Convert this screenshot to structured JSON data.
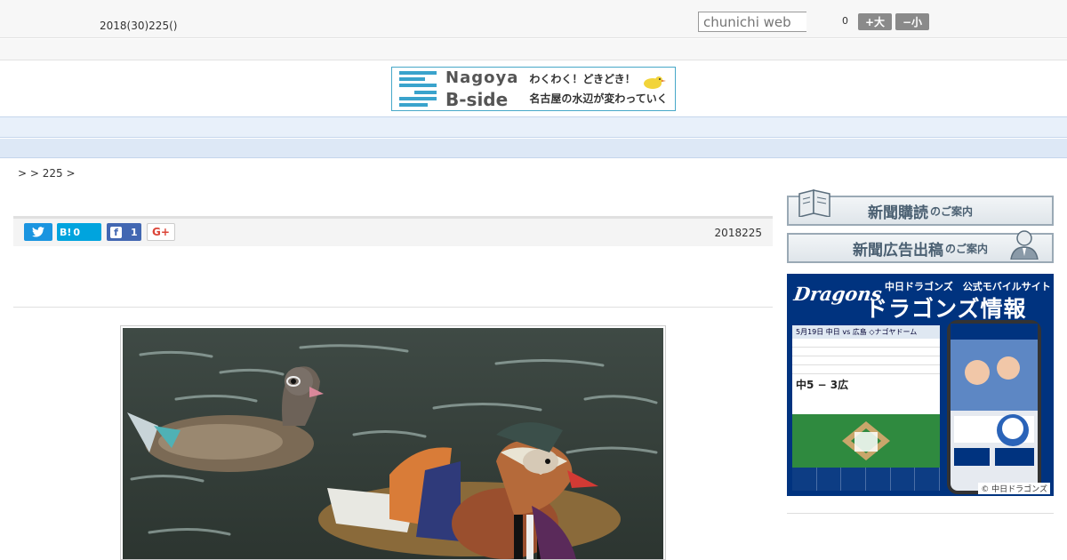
{
  "header": {
    "date": "2018(30)225()",
    "search_placeholder": "chunichi web",
    "fontsize_value": "0",
    "font_plus_label": "+大",
    "font_minus_label": "−小"
  },
  "banner": {
    "title_line1": "Nagoya",
    "title_line2": "B-side",
    "tagline1": "わくわく！どきどき！",
    "tagline2": "名古屋の水辺が変わっていく"
  },
  "nav": {
    "items": [
      "",
      "",
      "",
      "",
      "",
      "",
      "",
      "",
      ""
    ]
  },
  "breadcrumb": ">  > 225 >",
  "share": {
    "twitter_icon": "twitter-icon",
    "hatena_label": "B!",
    "hatena_count": "0",
    "facebook_label": "f",
    "facebook_count": "1",
    "gplus_label": "G+"
  },
  "article": {
    "date": "2018225",
    "photo_alt": "mandarin ducks"
  },
  "sidebar": {
    "subscribe_main": "新聞購読",
    "subscribe_small": "のご案内",
    "ad_main": "新聞広告出稿",
    "ad_small": "のご案内",
    "dragons": {
      "logo": "Dragons",
      "heading_small": "中日ドラゴンズ　公式モバイルサイト",
      "heading_large": "ドラゴンズ情報",
      "board_title": "5月19日 中日 vs 広島 ◇ナゴヤドーム",
      "score": "中5 − 3広",
      "footer": "© 中日ドラゴンズ"
    }
  },
  "colors": {
    "nav_bg": "#e8f0fa",
    "banner_border": "#47a8c8",
    "twitter": "#1b95e0",
    "hatena": "#00a4de",
    "facebook": "#4267b2",
    "dragons_blue": "#00337f"
  }
}
